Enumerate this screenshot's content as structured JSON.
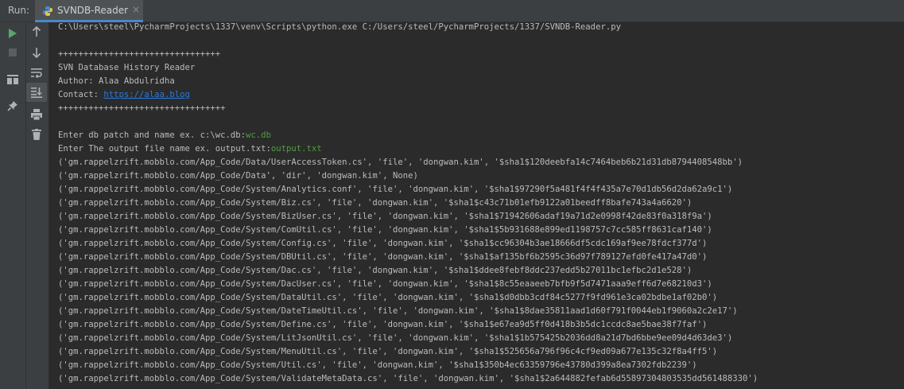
{
  "run_panel": {
    "label": "Run:",
    "tab_title": "SVNDB-Reader",
    "tab_close": "×"
  },
  "toolbar": {
    "run": "run-icon",
    "stop": "stop-icon",
    "up": "arrow-up-icon",
    "down": "arrow-down-icon",
    "layout": "layout-icon",
    "soft_wrap": "soft-wrap-icon",
    "scroll_end": "scroll-to-end-icon",
    "print": "print-icon",
    "pin": "pin-icon",
    "trash": "trash-icon"
  },
  "console": {
    "command": "C:\\Users\\steel\\PycharmProjects\\1337\\venv\\Scripts\\python.exe C:/Users/steel/PycharmProjects/1337/SVNDB-Reader.py",
    "banner_top": "++++++++++++++++++++++++++++++++",
    "banner_title": "SVN Database History Reader",
    "banner_author": "Author: Alaa Abdulridha",
    "banner_contact_label": "Contact: ",
    "banner_contact_link": "https://alaa.blog",
    "banner_bottom": "+++++++++++++++++++++++++++++++++",
    "prompt_db": "Enter db patch and name ex. c:\\wc.db:",
    "input_db": "wc.db",
    "prompt_output": "Enter The output file name ex. output.txt:",
    "input_output": "output.txt",
    "rows": [
      "('gm.rappelzrift.mobblo.com/App_Code/Data/UserAccessToken.cs', 'file', 'dongwan.kim', '$sha1$120deebfa14c7464beb6b21d31db8794408548bb')",
      "('gm.rappelzrift.mobblo.com/App_Code/Data', 'dir', 'dongwan.kim', None)",
      "('gm.rappelzrift.mobblo.com/App_Code/System/Analytics.conf', 'file', 'dongwan.kim', '$sha1$97290f5a481f4f4f435a7e70d1db56d2da62a9c1')",
      "('gm.rappelzrift.mobblo.com/App_Code/System/Biz.cs', 'file', 'dongwan.kim', '$sha1$c43c71b01efb9122a01beedff8bafe743a4a6620')",
      "('gm.rappelzrift.mobblo.com/App_Code/System/BizUser.cs', 'file', 'dongwan.kim', '$sha1$71942606adaf19a71d2e0998f42de83f0a318f9a')",
      "('gm.rappelzrift.mobblo.com/App_Code/System/ComUtil.cs', 'file', 'dongwan.kim', '$sha1$5b931688e899ed1198757c7cc585ff8631caf140')",
      "('gm.rappelzrift.mobblo.com/App_Code/System/Config.cs', 'file', 'dongwan.kim', '$sha1$cc96304b3ae18666df5cdc169af9ee78fdcf377d')",
      "('gm.rappelzrift.mobblo.com/App_Code/System/DBUtil.cs', 'file', 'dongwan.kim', '$sha1$af135bf6b2595c36d97f789127efd0fe417a47d0')",
      "('gm.rappelzrift.mobblo.com/App_Code/System/Dac.cs', 'file', 'dongwan.kim', '$sha1$ddee8febf8ddc237edd5b27011bc1efbc2d1e528')",
      "('gm.rappelzrift.mobblo.com/App_Code/System/DacUser.cs', 'file', 'dongwan.kim', '$sha1$8c55eaaeeb7bfb9f5d7471aaa9eff6d7e68210d3')",
      "('gm.rappelzrift.mobblo.com/App_Code/System/DataUtil.cs', 'file', 'dongwan.kim', '$sha1$d0dbb3cdf84c5277f9fd961e3ca02bdbe1af02b0')",
      "('gm.rappelzrift.mobblo.com/App_Code/System/DateTimeUtil.cs', 'file', 'dongwan.kim', '$sha1$8dae35811aad1d60f791f0044eb1f9060a2c2e17')",
      "('gm.rappelzrift.mobblo.com/App_Code/System/Define.cs', 'file', 'dongwan.kim', '$sha1$e67ea9d5ff0d418b3b5dc1ccdc8ae5bae38f7faf')",
      "('gm.rappelzrift.mobblo.com/App_Code/System/LitJsonUtil.cs', 'file', 'dongwan.kim', '$sha1$1b575425b2036dd8a21d7bd6bbe9ee09d4d63de3')",
      "('gm.rappelzrift.mobblo.com/App_Code/System/MenuUtil.cs', 'file', 'dongwan.kim', '$sha1$525656a796f96c4cf9ed09a677e135c32f8a4ff5')",
      "('gm.rappelzrift.mobblo.com/App_Code/System/Util.cs', 'file', 'dongwan.kim', '$sha1$350b4ec63359796e43780d399a8ea7302fdb2239')",
      "('gm.rappelzrift.mobblo.com/App_Code/System/ValidateMetaData.cs', 'file', 'dongwan.kim', '$sha1$2a644882fefab6d55897304803535dd561488330')"
    ]
  }
}
